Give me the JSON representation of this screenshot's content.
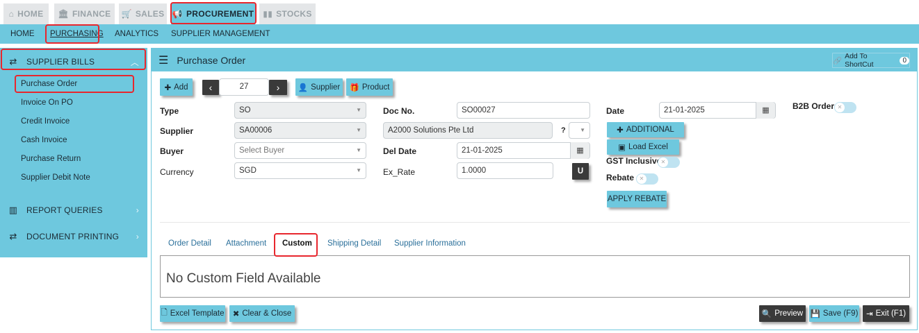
{
  "top_tabs": [
    {
      "label": "HOME",
      "icon": "home-icon"
    },
    {
      "label": "FINANCE",
      "icon": "bank-icon"
    },
    {
      "label": "SALES",
      "icon": "cart-icon"
    },
    {
      "label": "PROCUREMENT",
      "icon": "megaphone-icon"
    },
    {
      "label": "STOCKS",
      "icon": "bar-chart-icon"
    }
  ],
  "sub_nav": [
    "HOME",
    "PURCHASING",
    "ANALYTICS",
    "SUPPLIER MANAGEMENT"
  ],
  "sidebar": {
    "sections": [
      {
        "label": "SUPPLIER BILLS",
        "icon": "exchange-icon"
      },
      {
        "label": "REPORT QUERIES",
        "icon": "bar-chart-icon"
      },
      {
        "label": "DOCUMENT PRINTING",
        "icon": "exchange-icon"
      }
    ],
    "items": [
      "Purchase Order",
      "Invoice On PO",
      "Credit Invoice",
      "Cash Invoice",
      "Purchase Return",
      "Supplier Debit Note"
    ]
  },
  "panel": {
    "title": "Purchase Order",
    "shortcut_label": "Add To ShortCut",
    "shortcut_count": "0"
  },
  "toolbar": {
    "add": "Add",
    "record_no": "27",
    "supplier": "Supplier",
    "product": "Product"
  },
  "form": {
    "type_label": "Type",
    "type_value": "SO",
    "supplier_label": "Supplier",
    "supplier_value": "SA00006",
    "buyer_label": "Buyer",
    "buyer_placeholder": "Select Buyer",
    "currency_label": "Currency",
    "currency_value": "SGD",
    "docno_label": "Doc No.",
    "docno_value": "SO00027",
    "supplier_name": "A2000 Solutions Pte Ltd",
    "question": "?",
    "deldate_label": "Del Date",
    "deldate_value": "21-01-2025",
    "exrate_label": "Ex_Rate",
    "exrate_value": "1.0000",
    "u_button": "U",
    "date_label": "Date",
    "date_value": "21-01-2025",
    "additional": "ADDITIONAL",
    "load_excel": "Load Excel",
    "gst_label": "GST Inclusive",
    "rebate_label": "Rebate",
    "apply_rebate": "APPLY REBATE",
    "b2b_label": "B2B Order"
  },
  "tabs": [
    "Order Detail",
    "Attachment",
    "Custom",
    "Shipping Detail",
    "Supplier Information"
  ],
  "custom_message": "No Custom Field Available",
  "footer": {
    "excel_template": "Excel Template",
    "clear_close": "Clear & Close",
    "preview": "Preview",
    "save": "Save (F9)",
    "exit": "Exit (F1)"
  },
  "colors": {
    "accent": "#6ec8de",
    "highlight": "#e8262d",
    "dark_button": "#3a3a3a"
  }
}
